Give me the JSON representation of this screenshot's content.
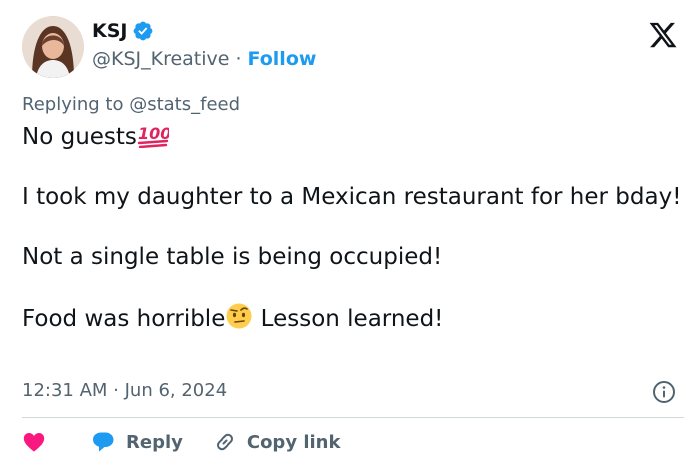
{
  "author": {
    "display_name": "KSJ",
    "handle": "@KSJ_Kreative",
    "separator": "·",
    "follow_label": "Follow"
  },
  "reply_context": {
    "prefix": "Replying to ",
    "mention": "@stats_feed"
  },
  "tweet": {
    "line1": "No guests",
    "line1_emoji": "hundred-points",
    "line2": "I took my daughter to a Mexican restaurant for her bday!",
    "line3": "Not a single table is being occupied!",
    "line4a": "Food was horrible",
    "line4_emoji": "face-with-raised-eyebrow",
    "line4b": " Lesson learned!"
  },
  "timestamp": "12:31 AM · Jun 6, 2024",
  "actions": {
    "reply_label": "Reply",
    "copy_link_label": "Copy link"
  },
  "colors": {
    "accent": "#1d9bf0",
    "like": "#f91880",
    "muted": "#536471",
    "text": "#0f1419"
  }
}
